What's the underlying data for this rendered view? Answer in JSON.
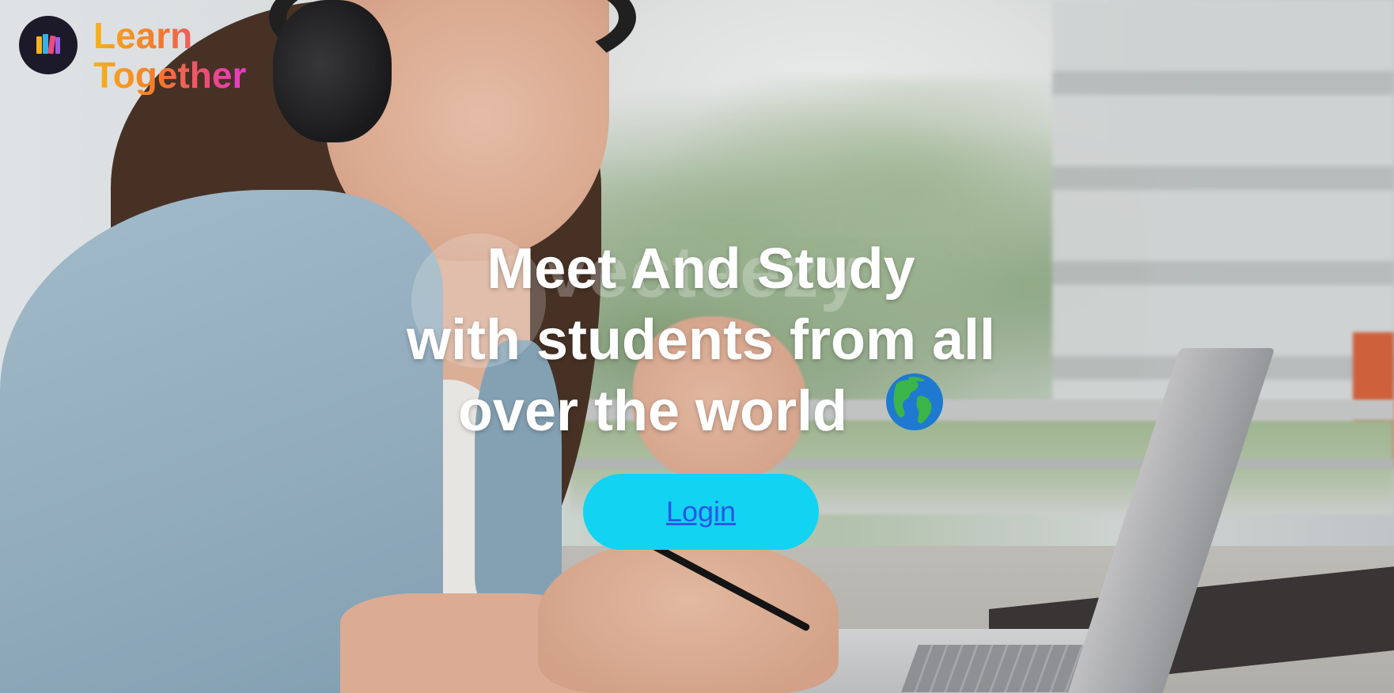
{
  "brand": {
    "logo_icon": "books-icon",
    "name_line1": "Learn",
    "name_line2": "Together",
    "gradient_colors": [
      "#f6b21b",
      "#f2772f",
      "#ec4b7e",
      "#e63ad0"
    ],
    "badge_color": "#1c1a28"
  },
  "hero": {
    "headline_line1": "Meet And Study",
    "headline_line2": "with students from all",
    "headline_line3": "over the world",
    "headline_emoji_icon": "globe-americas-icon",
    "watermark": "vecteezy",
    "background_image": "student-with-headphones-laptop-photo"
  },
  "actions": {
    "login_label": "Login",
    "login_bg_color": "#12d3f1",
    "login_text_color": "#2b55e6"
  }
}
